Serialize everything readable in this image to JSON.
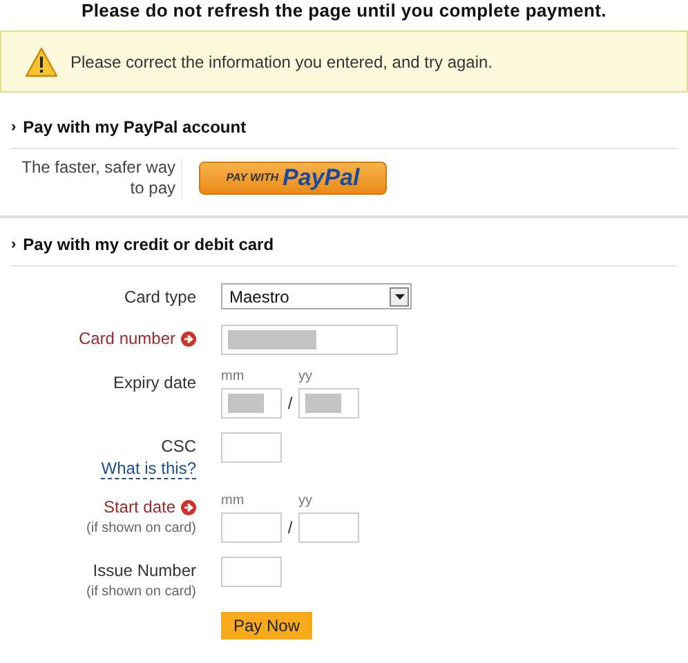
{
  "notice": "Please do not refresh the page until you complete payment.",
  "alert": {
    "kind": "warning",
    "message": "Please correct the information you entered, and try again."
  },
  "paypal_section": {
    "marker": "›",
    "title": "Pay with my PayPal account",
    "tagline": "The faster, safer way to pay",
    "button": {
      "prefix": "PAY WITH",
      "brand": "PayPal"
    }
  },
  "card_section": {
    "marker": "›",
    "title": "Pay with my credit or debit card",
    "fields": [
      {
        "kind": "select",
        "label": "Card type",
        "value": "Maestro",
        "error": false
      },
      {
        "kind": "text",
        "label": "Card number",
        "error": true,
        "redacted": true
      },
      {
        "kind": "date",
        "label": "Expiry date",
        "error": false,
        "parts": [
          {
            "caption": "mm",
            "redacted": true
          },
          {
            "caption": "yy",
            "redacted": true
          }
        ],
        "separator": "/"
      },
      {
        "kind": "short",
        "label": "CSC",
        "link": "What is this?",
        "error": false,
        "redacted": false
      },
      {
        "kind": "date",
        "label": "Start date",
        "note": "(if shown on card)",
        "error": true,
        "parts": [
          {
            "caption": "mm",
            "redacted": false
          },
          {
            "caption": "yy",
            "redacted": false
          }
        ],
        "separator": "/"
      },
      {
        "kind": "short",
        "label": "Issue Number",
        "note": "(if shown on card)",
        "error": false,
        "redacted": false
      }
    ],
    "submit": "Pay Now"
  }
}
